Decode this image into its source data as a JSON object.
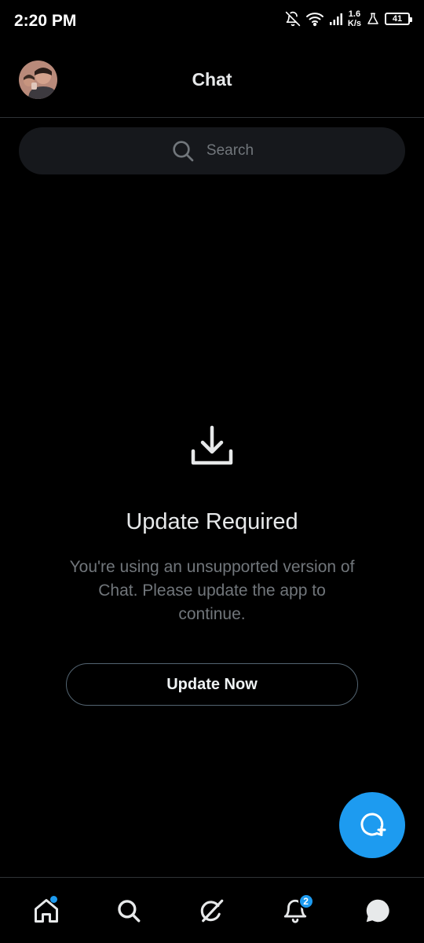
{
  "status_bar": {
    "time": "2:20 PM",
    "net_speed_value": "1.6",
    "net_speed_unit": "K/s",
    "battery": "41"
  },
  "header": {
    "title": "Chat"
  },
  "search": {
    "placeholder": "Search"
  },
  "update": {
    "title": "Update Required",
    "message": "You're using an unsupported version of Chat. Please update the app to continue.",
    "button_label": "Update Now"
  },
  "bottom_nav": {
    "notification_count": "2",
    "items": [
      "home-icon",
      "search-icon",
      "grok-icon",
      "bell-icon",
      "chat-bubble-icon"
    ]
  },
  "colors": {
    "accent": "#1d9bf0",
    "background": "#000000",
    "secondary_text": "#71767b"
  }
}
